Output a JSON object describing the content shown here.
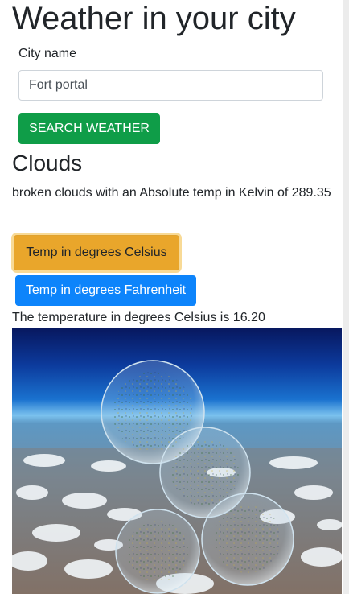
{
  "page": {
    "title": "Weather in your city"
  },
  "form": {
    "city_label": "City name",
    "city_value": "Fort portal",
    "search_button": "SEARCH WEATHER"
  },
  "result": {
    "heading": "Clouds",
    "description": "broken clouds with an Absolute temp in Kelvin of 289.35",
    "celsius_button": "Temp in degrees Celsius",
    "fahrenheit_button": "Temp in degrees Fahrenheit",
    "temperature_line": "The temperature in degrees Celsius is 16.20"
  },
  "colors": {
    "search_button": "#0f9d48",
    "celsius_button": "#e9a62b",
    "fahrenheit_button": "#0d84fb"
  }
}
